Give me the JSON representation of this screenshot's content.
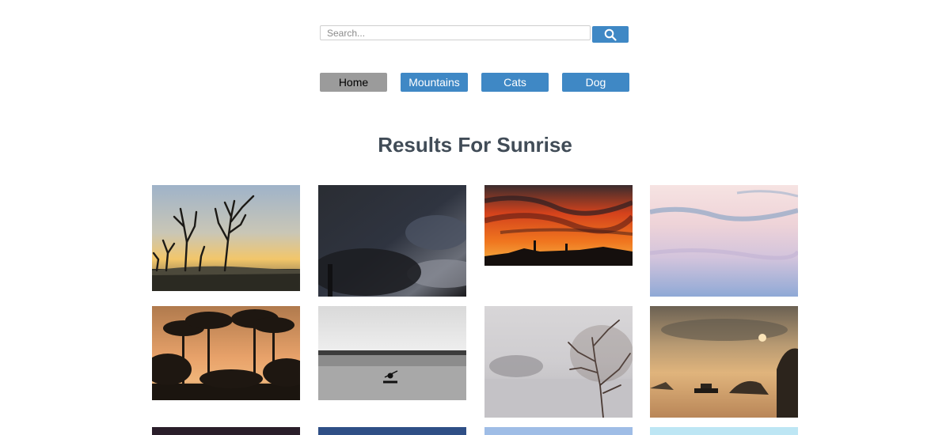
{
  "search": {
    "placeholder": "Search...",
    "value": "",
    "button_icon": "search-icon"
  },
  "nav": {
    "items": [
      {
        "label": "Home",
        "active": true
      },
      {
        "label": "Mountains",
        "active": false
      },
      {
        "label": "Cats",
        "active": false
      },
      {
        "label": "Dog",
        "active": false
      }
    ]
  },
  "results": {
    "title": "Results For Sunrise"
  },
  "colors": {
    "accent": "#3f88c5",
    "active_nav": "#9b9b9b",
    "heading": "#414c57"
  },
  "images": [
    {
      "name": "dead-trees-sunset"
    },
    {
      "name": "dark-clouds"
    },
    {
      "name": "red-desert-sunset"
    },
    {
      "name": "pastel-sky"
    },
    {
      "name": "palm-trees-sunset"
    },
    {
      "name": "kayak-lake-bw"
    },
    {
      "name": "misty-tree-lake"
    },
    {
      "name": "bay-boat-sunrise"
    },
    {
      "name": "partial-dark-purple"
    },
    {
      "name": "partial-dark-blue"
    },
    {
      "name": "partial-light-blue"
    },
    {
      "name": "partial-sky-blue"
    }
  ]
}
